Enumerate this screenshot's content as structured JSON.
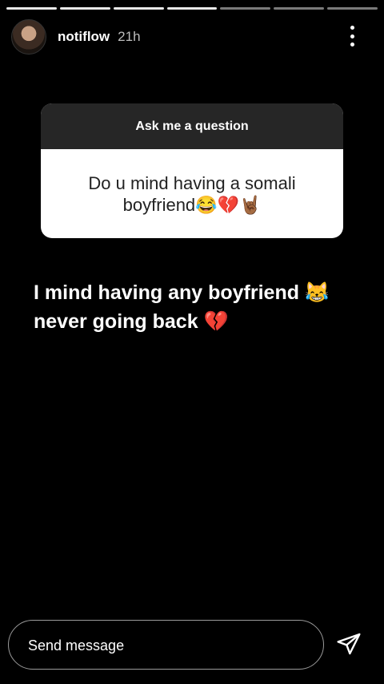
{
  "story": {
    "segments": {
      "completed": 4,
      "total": 7
    }
  },
  "header": {
    "username": "notiflow",
    "time_ago": "21h",
    "more_icon": "more-vertical-icon"
  },
  "question_sticker": {
    "header": "Ask me a question",
    "question": "Do u mind having a somali boyfriend😂💔🤘🏾"
  },
  "caption": {
    "line1": "I mind having any boyfriend 😹",
    "line2": "never going back 💔"
  },
  "footer": {
    "message_placeholder": "Send message",
    "send_icon": "send-icon"
  }
}
